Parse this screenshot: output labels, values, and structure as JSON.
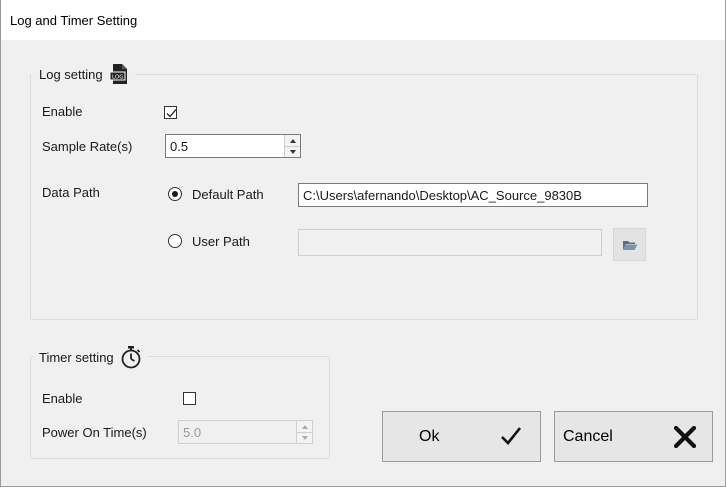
{
  "window": {
    "title": "Log and Timer Setting"
  },
  "log_setting": {
    "legend": "Log setting",
    "legend_icon": "log-file-icon",
    "enable_label": "Enable",
    "enable_checked": true,
    "sample_rate_label": "Sample Rate(s)",
    "sample_rate_value": "0.5",
    "data_path_label": "Data Path",
    "default_path_label": "Default Path",
    "default_path_selected": true,
    "default_path_value": "C:\\Users\\afernando\\Desktop\\AC_Source_9830B",
    "user_path_label": "User Path",
    "user_path_value": "",
    "browse_icon": "folder-open-icon"
  },
  "timer_setting": {
    "legend": "Timer setting",
    "legend_icon": "stopwatch-icon",
    "enable_label": "Enable",
    "enable_checked": false,
    "power_on_time_label": "Power On Time(s)",
    "power_on_time_value": "5.0"
  },
  "buttons": {
    "ok_label": "Ok",
    "ok_icon": "checkmark-icon",
    "cancel_label": "Cancel",
    "cancel_icon": "close-x-icon"
  }
}
